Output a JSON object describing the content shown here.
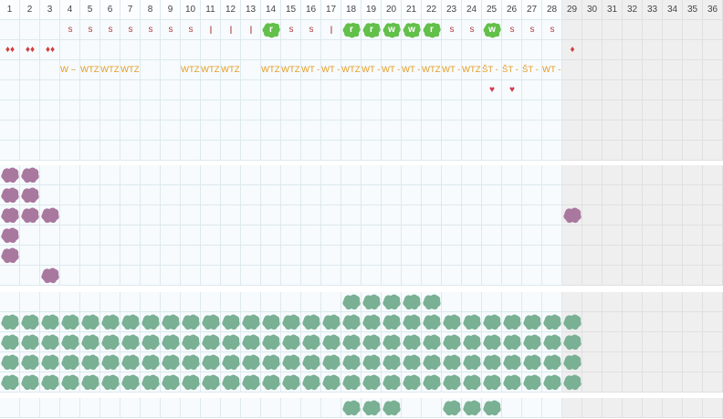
{
  "day_numbers": [
    "1",
    "2",
    "3",
    "4",
    "5",
    "6",
    "7",
    "8",
    "9",
    "10",
    "11",
    "12",
    "13",
    "14",
    "15",
    "16",
    "17",
    "18",
    "19",
    "20",
    "21",
    "22",
    "23",
    "24",
    "25",
    "26",
    "27",
    "28",
    "29",
    "30",
    "31",
    "32",
    "33",
    "34",
    "35",
    "36"
  ],
  "active_days": 28,
  "colors": {
    "purple_block": "#a9789f",
    "teal_block": "#7ab094",
    "green_badge": "#63c04a",
    "mark_red": "#b04040",
    "shift_orange": "#e39a1e",
    "heart_red": "#d63b4f"
  },
  "row1_marks": [
    {
      "day": 4,
      "text": "s"
    },
    {
      "day": 5,
      "text": "s"
    },
    {
      "day": 6,
      "text": "s"
    },
    {
      "day": 7,
      "text": "s"
    },
    {
      "day": 8,
      "text": "s"
    },
    {
      "day": 9,
      "text": "s"
    },
    {
      "day": 10,
      "text": "s"
    },
    {
      "day": 11,
      "text": "l"
    },
    {
      "day": 12,
      "text": "l"
    },
    {
      "day": 13,
      "text": "l"
    },
    {
      "day": 15,
      "text": "s"
    },
    {
      "day": 16,
      "text": "s"
    },
    {
      "day": 17,
      "text": "l"
    },
    {
      "day": 23,
      "text": "s"
    },
    {
      "day": 24,
      "text": "s"
    },
    {
      "day": 26,
      "text": "s"
    },
    {
      "day": 27,
      "text": "s"
    },
    {
      "day": 28,
      "text": "s"
    }
  ],
  "row1_badges": [
    {
      "day": 14,
      "text": "r"
    },
    {
      "day": 18,
      "text": "r"
    },
    {
      "day": 19,
      "text": "r"
    },
    {
      "day": 20,
      "text": "w"
    },
    {
      "day": 21,
      "text": "w"
    },
    {
      "day": 22,
      "text": "r"
    },
    {
      "day": 25,
      "text": "w"
    }
  ],
  "row2_drops": [
    {
      "day": 1,
      "text": "♦♦"
    },
    {
      "day": 2,
      "text": "♦♦"
    },
    {
      "day": 3,
      "text": "♦♦"
    },
    {
      "day": 29,
      "text": "♦"
    }
  ],
  "row3_shifts": [
    {
      "day": 4,
      "text": "W -"
    },
    {
      "day": 5,
      "text": "-"
    },
    {
      "day": 5,
      "text": "WTZ"
    },
    {
      "day": 6,
      "text": "WTZ"
    },
    {
      "day": 7,
      "text": "WTZ"
    },
    {
      "day": 10,
      "text": "WTZ"
    },
    {
      "day": 11,
      "text": "WTZ"
    },
    {
      "day": 12,
      "text": "WTZ"
    },
    {
      "day": 14,
      "text": "WTZ"
    },
    {
      "day": 15,
      "text": "WTZ"
    },
    {
      "day": 16,
      "text": "WT -"
    },
    {
      "day": 17,
      "text": "WT -"
    },
    {
      "day": 18,
      "text": "WTZ"
    },
    {
      "day": 19,
      "text": "WT -"
    },
    {
      "day": 20,
      "text": "WT -"
    },
    {
      "day": 21,
      "text": "WT -"
    },
    {
      "day": 22,
      "text": "WTZ"
    },
    {
      "day": 23,
      "text": "WT -"
    },
    {
      "day": 24,
      "text": "WTZ"
    },
    {
      "day": 25,
      "text": "ŠT -"
    },
    {
      "day": 26,
      "text": "ŠT -"
    },
    {
      "day": 27,
      "text": "ŠT -"
    },
    {
      "day": 28,
      "text": "WT -"
    }
  ],
  "row4_hearts": [
    {
      "day": 25,
      "text": "♥"
    },
    {
      "day": 26,
      "text": "♥"
    }
  ],
  "purple_blocks": [
    {
      "day": 1,
      "row": 0
    },
    {
      "day": 2,
      "row": 0
    },
    {
      "day": 1,
      "row": 1
    },
    {
      "day": 2,
      "row": 1
    },
    {
      "day": 1,
      "row": 2
    },
    {
      "day": 2,
      "row": 2
    },
    {
      "day": 3,
      "row": 2
    },
    {
      "day": 29,
      "row": 2
    },
    {
      "day": 1,
      "row": 3
    },
    {
      "day": 1,
      "row": 4
    },
    {
      "day": 3,
      "row": 5
    }
  ],
  "teal_top_row_days": [
    18,
    19,
    20,
    21,
    22
  ],
  "teal_full_rows": 4,
  "teal_full_days": 29,
  "bottom_blocks_days": [
    18,
    19,
    20,
    23,
    24,
    25
  ]
}
